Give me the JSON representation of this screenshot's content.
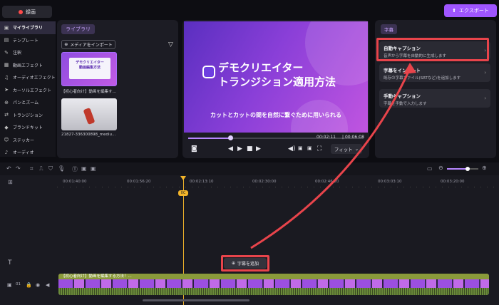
{
  "topbar": {
    "record_label": "録画",
    "export_label": "エクスポート"
  },
  "sidebar": {
    "items": [
      {
        "label": "マイライブラリ",
        "icon": "folder-icon",
        "active": true
      },
      {
        "label": "テンプレート",
        "icon": "template-icon",
        "active": false
      },
      {
        "label": "注釈",
        "icon": "annotation-icon",
        "active": false
      },
      {
        "label": "動画エフェクト",
        "icon": "effect-icon",
        "active": false
      },
      {
        "label": "オーディオエフェクト",
        "icon": "audio-effect-icon",
        "active": false
      },
      {
        "label": "カーソルエフェクト",
        "icon": "cursor-icon",
        "active": false
      },
      {
        "label": "パンとズーム",
        "icon": "zoom-icon",
        "active": false
      },
      {
        "label": "トランジション",
        "icon": "transition-icon",
        "active": false
      },
      {
        "label": "ブランドキット",
        "icon": "brand-icon",
        "active": false
      },
      {
        "label": "ステッカー",
        "icon": "sticker-icon",
        "active": false
      },
      {
        "label": "オーディオ",
        "icon": "audio-icon",
        "active": false
      }
    ]
  },
  "library": {
    "tab_label": "ライブラリ",
    "import_label": "メディアをインポート",
    "items": [
      {
        "caption": "【初心者向け】動画を編集す...",
        "thumb_text": "デモクリエイター\n動画編集方法"
      },
      {
        "caption": "21827-336300898_mediu..."
      }
    ]
  },
  "preview": {
    "title_line1": "デモクリエイター",
    "title_line2": "トランジション適用方法",
    "subtitle": "カットとカットの間を自然に繋ぐために用いられる",
    "current_time": "00:02:11",
    "total_time": "00:06:08",
    "progress": 0.24,
    "fit_label": "フィット"
  },
  "captions": {
    "tab_label": "字幕",
    "cards": [
      {
        "title": "自動キャプション",
        "desc": "音声から字幕を自動的に生成します"
      },
      {
        "title": "字幕をインポート",
        "desc": "既存の字幕ファイル(SRTなど)を追加します"
      },
      {
        "title": "手動キャプション",
        "desc": "字幕を手動で入力します"
      }
    ]
  },
  "timeline": {
    "ruler": [
      "00:01:40:00",
      "00:01:56:20",
      "00:02:13:10",
      "00:02:30:00",
      "00:02:46:20",
      "00:03:03:10",
      "00:03:20:00"
    ],
    "playhead_label": "0C",
    "add_caption_label": "字幕を追加",
    "clip_title": "【初心者向け】動画を編集する方法！...",
    "track_number": "01"
  },
  "colors": {
    "accent": "#9f55ff",
    "highlight": "#e8444b",
    "playhead": "#f3b52a"
  }
}
